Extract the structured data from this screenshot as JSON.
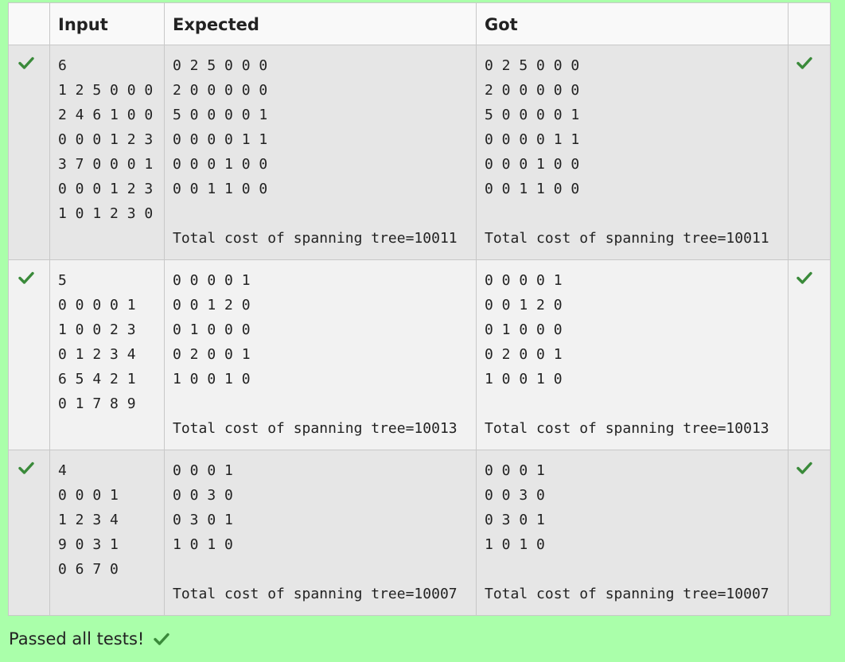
{
  "colors": {
    "page_background": "#aaffaa",
    "check_green": "#3a8a3a",
    "row_odd": "#e6e6e6",
    "row_even": "#f2f2f2",
    "header_bg": "#f9f9f9"
  },
  "table": {
    "headers": {
      "input": "Input",
      "expected": "Expected",
      "got": "Got"
    },
    "rows": [
      {
        "status_icon": "check-icon",
        "input": "6\n1 2 5 0 0 0\n2 4 6 1 0 0\n0 0 0 1 2 3\n3 7 0 0 0 1\n0 0 0 1 2 3\n1 0 1 2 3 0",
        "expected": "0 2 5 0 0 0\n2 0 0 0 0 0\n5 0 0 0 0 1\n0 0 0 0 1 1\n0 0 0 1 0 0\n0 0 1 1 0 0\n\nTotal cost of spanning tree=10011",
        "got": "0 2 5 0 0 0\n2 0 0 0 0 0\n5 0 0 0 0 1\n0 0 0 0 1 1\n0 0 0 1 0 0\n0 0 1 1 0 0\n\nTotal cost of spanning tree=10011"
      },
      {
        "status_icon": "check-icon",
        "input": "5\n0 0 0 0 1\n1 0 0 2 3\n0 1 2 3 4\n6 5 4 2 1\n0 1 7 8 9",
        "expected": "0 0 0 0 1\n0 0 1 2 0\n0 1 0 0 0\n0 2 0 0 1\n1 0 0 1 0\n\nTotal cost of spanning tree=10013",
        "got": "0 0 0 0 1\n0 0 1 2 0\n0 1 0 0 0\n0 2 0 0 1\n1 0 0 1 0\n\nTotal cost of spanning tree=10013"
      },
      {
        "status_icon": "check-icon",
        "input": "4\n0 0 0 1\n1 2 3 4\n9 0 3 1\n0 6 7 0",
        "expected": "0 0 0 1\n0 0 3 0\n0 3 0 1\n1 0 1 0\n\nTotal cost of spanning tree=10007",
        "got": "0 0 0 1\n0 0 3 0\n0 3 0 1\n1 0 1 0\n\nTotal cost of spanning tree=10007"
      }
    ]
  },
  "footer": {
    "message": "Passed all tests!",
    "icon": "check-icon"
  }
}
